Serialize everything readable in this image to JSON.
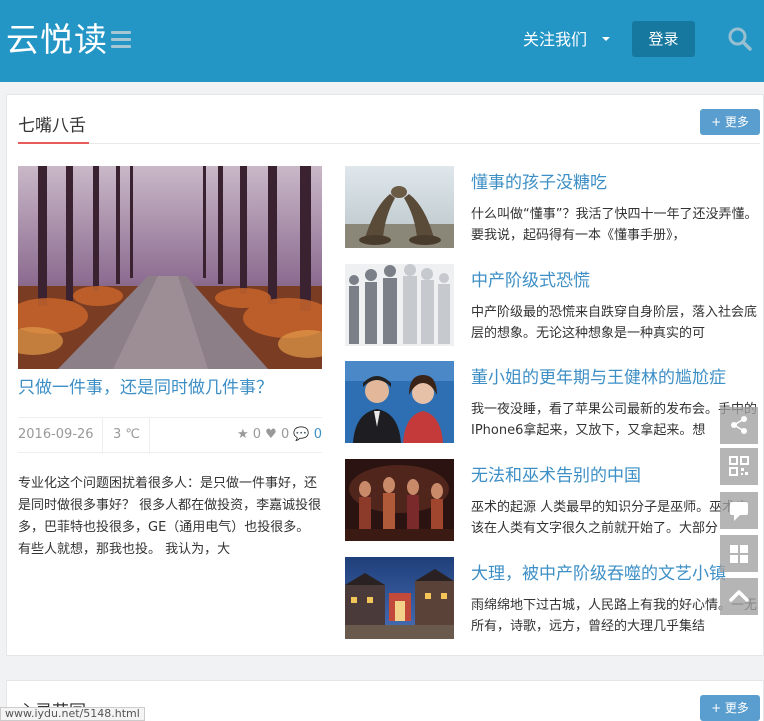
{
  "header": {
    "logo": "云悦读",
    "follow_label": "关注我们",
    "login_label": "登录"
  },
  "section1": {
    "title": "七嘴八舌",
    "more_label": "+ 更多",
    "feature": {
      "title": "只做一件事，还是同时做几件事？",
      "date": "2016-09-26",
      "temp": "3 ℃",
      "stars": "0",
      "likes": "0",
      "comments": "0",
      "excerpt": "专业化这个问题困扰着很多人：是只做一件事好，还是同时做很多事好？ 很多人都在做投资，李嘉诚投很多，巴菲特也投很多，GE（通用电气）也投很多。有些人就想，那我也投。 我认为，大"
    },
    "items": [
      {
        "title": "懂事的孩子没糖吃",
        "text": "什么叫做“懂事”？我活了快四十一年了还没弄懂。要我说，起码得有一本《懂事手册》，"
      },
      {
        "title": "中产阶级式恐慌",
        "text": "中产阶级最的恐慌来自跌穿自身阶层，落入社会底层的想象。无论这种想象是一种真实的可"
      },
      {
        "title": "董小姐的更年期与王健林的尴尬症",
        "text": "我一夜没睡，看了苹果公司最新的发布会。手中的IPhone6拿起来，又放下，又拿起来。想"
      },
      {
        "title": "无法和巫术告别的中国",
        "text": "巫术的起源 人类最早的知识分子是巫师。巫术应该在人类有文字很久之前就开始了。大部分"
      },
      {
        "title": "大理，被中产阶级吞噬的文艺小镇",
        "text": "雨绵绵地下过古城，人民路上有我的好心情。一无所有，诗歌，远方，曾经的大理几乎集结"
      }
    ]
  },
  "section2": {
    "title": "心灵花园",
    "more_label": "+ 更多"
  },
  "status_url": "www.iydu.net/5148.html",
  "colors": {
    "header_bg": "#2496c6",
    "link_blue": "#3d8fc6",
    "accent_red": "#e85c5c",
    "button_blue": "#5a9ecf"
  }
}
